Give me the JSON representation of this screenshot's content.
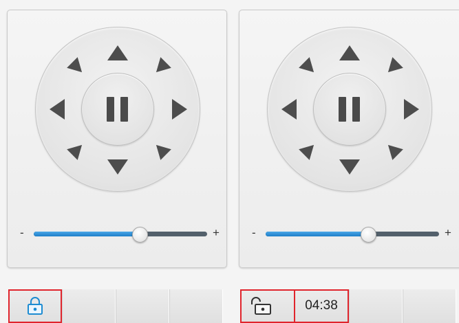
{
  "panels": [
    {
      "id": "left",
      "zoom": {
        "minus_label": "-",
        "plus_label": "+",
        "level": 0.61
      },
      "lock_state": "locked",
      "lock_icon": "lock-closed-icon",
      "accent_color": "#1f7fc9"
    },
    {
      "id": "right",
      "zoom": {
        "minus_label": "-",
        "plus_label": "+",
        "level": 0.59
      },
      "lock_state": "unlocked",
      "lock_icon": "lock-open-icon",
      "timer": "04:38"
    }
  ],
  "colors": {
    "highlight": "#e0242c",
    "slider_fill": "#1f7fc9",
    "slider_track": "#53606b"
  }
}
